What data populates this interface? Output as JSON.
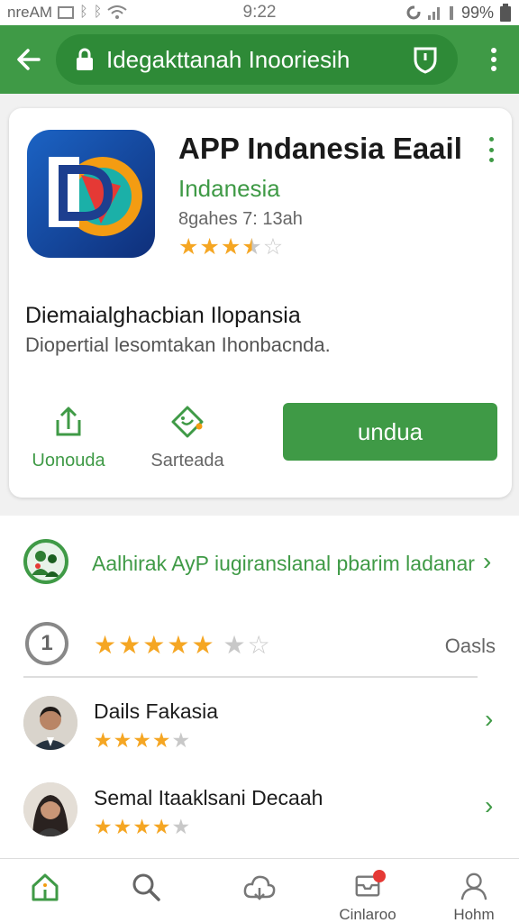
{
  "status_bar": {
    "carrier": "nreAM",
    "time": "9:22",
    "battery": "99%",
    "icons": [
      "screenshot-icon",
      "bluetooth-icon",
      "bluetooth-icon",
      "wifi-icon",
      "sync-icon",
      "signal-icon",
      "signal-icon"
    ]
  },
  "top_bar": {
    "url": "Idegakttanah Inooriesih",
    "back_icon": "arrow-left-icon",
    "lock_icon": "lock-icon",
    "shield_icon": "shield-icon",
    "menu_icon": "more-vert-icon"
  },
  "app": {
    "title": "APP Indanesia Eaail",
    "developer": "Indanesia",
    "meta": "8gahes 7: 13ah",
    "rating_stars": 3.5,
    "description_title": "Diemaialghacbian Ilopansia",
    "description_sub": "Diopertial lesomtakan Ihonbacnda.",
    "share_label": "Uonouda",
    "save_label": "Sarteada",
    "install_label": "undua"
  },
  "promo": {
    "text": "Aalhirak AyP iugiranslanal pbarim ladanar"
  },
  "rating_summary": {
    "badge": "1",
    "stars": 5,
    "link": "Oasls"
  },
  "reviews": [
    {
      "name": "Dails Fakasia",
      "stars": 4
    },
    {
      "name": "Semal Itaaklsani Decaah",
      "stars": 4
    }
  ],
  "bottom_nav": {
    "items": [
      {
        "icon": "home-icon",
        "label": ""
      },
      {
        "icon": "search-icon",
        "label": ""
      },
      {
        "icon": "cloud-icon",
        "label": ""
      },
      {
        "icon": "inbox-icon",
        "label": "Cinlaroo"
      },
      {
        "icon": "user-icon",
        "label": "Hohm"
      }
    ]
  },
  "colors": {
    "brand_green": "#3f9a46",
    "star_gold": "#f5a623",
    "badge_red": "#e53935"
  }
}
